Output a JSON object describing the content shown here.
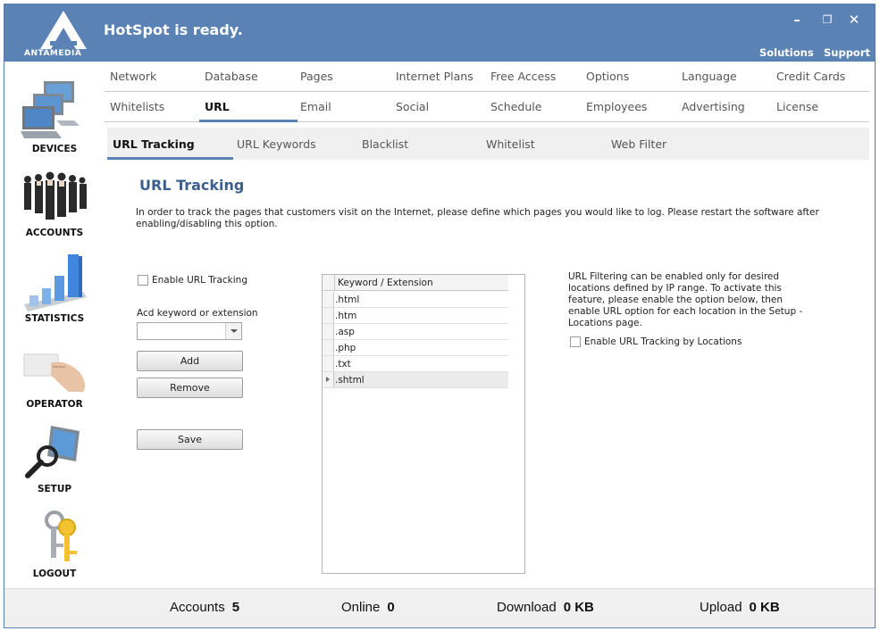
{
  "header": {
    "title": "HotSpot is ready.",
    "logo_text": "ANTAMEDIA",
    "minimize": "–",
    "restore": "❐",
    "close": "✕",
    "links": [
      "Solutions",
      "Support"
    ]
  },
  "sidebar": {
    "items": [
      {
        "label": "DEVICES",
        "icon": "devices-icon"
      },
      {
        "label": "ACCOUNTS",
        "icon": "accounts-icon"
      },
      {
        "label": "STATISTICS",
        "icon": "statistics-icon"
      },
      {
        "label": "OPERATOR",
        "icon": "operator-icon"
      },
      {
        "label": "SETUP",
        "icon": "setup-icon"
      },
      {
        "label": "LOGOUT",
        "icon": "logout-icon"
      }
    ]
  },
  "nav": {
    "row1": [
      "Network",
      "Database",
      "Pages",
      "Internet Plans",
      "Free Access",
      "Options",
      "Language",
      "Credit Cards"
    ],
    "row2": [
      "Whitelists",
      "URL",
      "Email",
      "Social",
      "Schedule",
      "Employees",
      "Advertising",
      "License"
    ],
    "active": "URL"
  },
  "subtabs": {
    "items": [
      "URL Tracking",
      "URL Keywords",
      "Blacklist",
      "Whitelist",
      "Web Filter"
    ],
    "active": "URL Tracking"
  },
  "main": {
    "title": "URL Tracking",
    "description": "In order to track the pages that customers visit on the Internet, please define which pages you would like to log.  Please restart the software after enabling/disabling this option.",
    "enable_label": "Enable URL Tracking",
    "keyword_label": "Acd keyword or extension",
    "keyword_value": "",
    "add_button": "Add",
    "remove_button": "Remove",
    "save_button": "Save",
    "grid": {
      "header": "Keyword / Extension",
      "rows": [
        ".html",
        ".htm",
        ".asp",
        ".php",
        ".txt",
        ".shtml"
      ],
      "selected_row": ".shtml"
    },
    "info": "URL Filtering can be enabled only for desired locations defined by IP range.  To activate this feature, please enable the option below, then enable URL option for each location in the Setup - Locations page.",
    "locations_label": "Enable URL Tracking by Locations"
  },
  "footer": {
    "accounts_label": "Accounts",
    "accounts_value": "5",
    "online_label": "Online",
    "online_value": "0",
    "download_label": "Download",
    "download_value": "0 KB",
    "upload_label": "Upload",
    "upload_value": "0 KB"
  }
}
